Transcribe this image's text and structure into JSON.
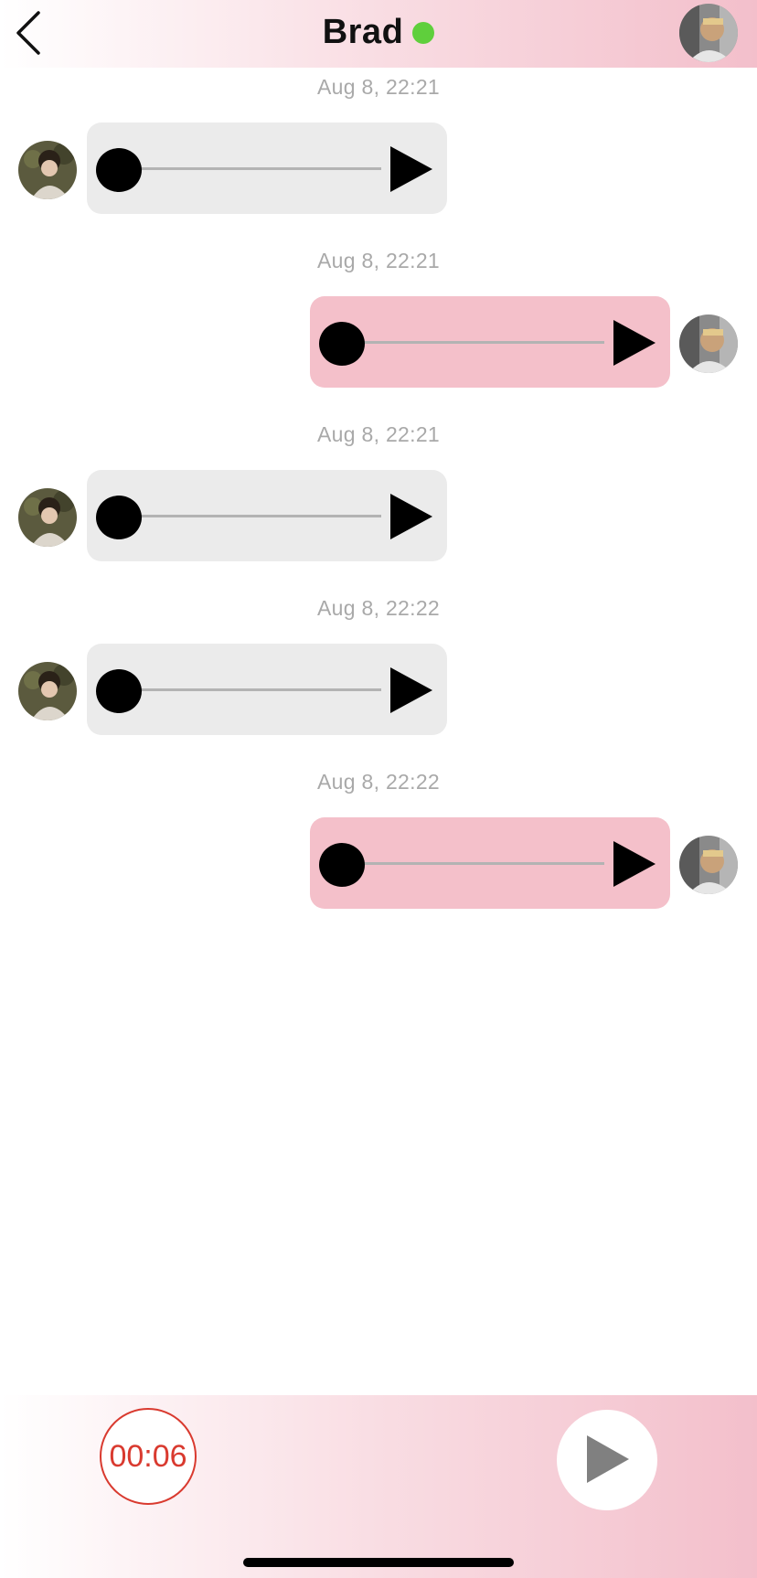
{
  "header": {
    "title": "Brad",
    "online": true,
    "online_color": "#5fcf3c",
    "back_icon": "chevron-left-icon",
    "avatar": "user-avatar"
  },
  "messages": [
    {
      "timestamp": "Aug 8,  22:21",
      "direction": "incoming",
      "type": "voice",
      "progress": 0
    },
    {
      "timestamp": "Aug 8,  22:21",
      "direction": "outgoing",
      "type": "voice",
      "progress": 0
    },
    {
      "timestamp": "Aug 8,  22:21",
      "direction": "incoming",
      "type": "voice",
      "progress": 0
    },
    {
      "timestamp": "Aug 8,  22:22",
      "direction": "incoming",
      "type": "voice",
      "progress": 0
    },
    {
      "timestamp": "Aug 8,  22:22",
      "direction": "outgoing",
      "type": "voice",
      "progress": 0
    }
  ],
  "bottom_bar": {
    "timer": "00:06",
    "timer_color": "#d93a2f",
    "play_icon": "play-icon"
  },
  "colors": {
    "incoming_bubble": "#ebebeb",
    "outgoing_bubble": "#f4c0ca",
    "accent_pink": "#f3bfcb"
  }
}
